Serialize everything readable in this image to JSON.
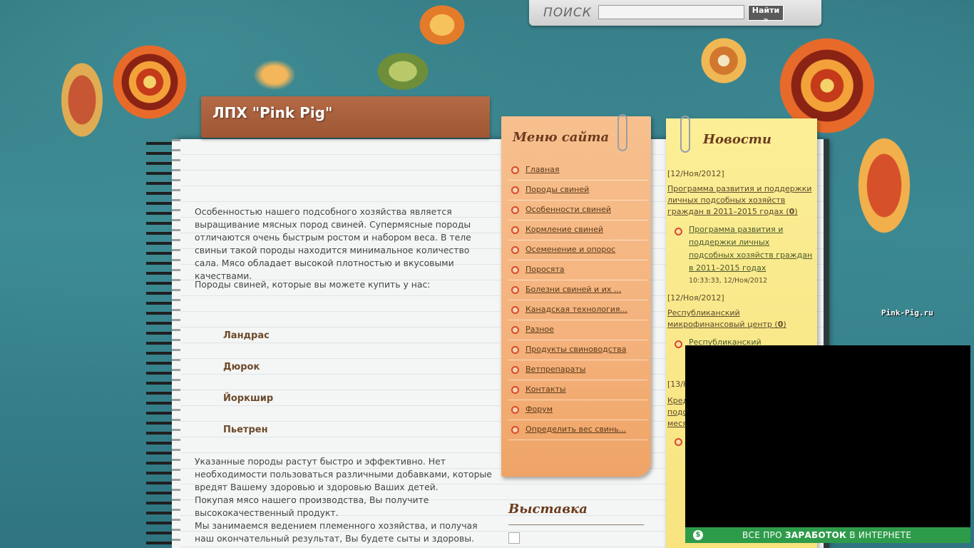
{
  "search": {
    "label": "ПОИСК",
    "input_value": "",
    "button_label": "Найти »"
  },
  "site": {
    "title": "ЛПХ \"Pink Pig\""
  },
  "main": {
    "intro": "Особенностью нашего подсобного хозяйства является выращивание мясных пород свиней. Супермясные породы отличаются очень быстрым ростом и набором веса. В  теле свиньи такой породы находится минимальное количество сала. Мясо обладает высокой плотностью и вкусовыми качествами.",
    "breeds_heading": "Породы свиней, которые вы можете купить у нас:",
    "breeds": [
      "Ландрас",
      "Дюрок",
      "Йоркшир",
      "Пьетрен"
    ],
    "outro_1": "Указанные породы растут быстро и эффективно.  Нет необходимости пользоваться различными добавками, которые вредят Вашему здоровью и здоровью Ваших детей.",
    "outro_2": "Покупая мясо нашего производства,  Вы получите высококачественный продукт.",
    "outro_3": "Мы занимаемся ведением племенного хозяйства, и получая наш окончательный результат,  Вы будете сыты и здоровы."
  },
  "menu": {
    "title": "Меню сайта",
    "items": [
      "Главная",
      "Породы свиней",
      "Особенности свиней",
      "Кормление свиней",
      "Осеменение и опорос",
      "Поросята",
      "Болезни свиней и их ...",
      "Канадская технология...",
      "Разное",
      "Продукты свиноводства",
      "Ветпрепараты",
      "Контакты",
      "Форум",
      "Определить вес свинь..."
    ]
  },
  "exhibition": {
    "title": "Выставка"
  },
  "news": {
    "title": "Новости",
    "item1_date": "[12/Ноя/2012]",
    "item1_link": "Программа развития и поддержки личных подсобных хозяйств граждан в 2011–2015 годах",
    "item1_count": "0",
    "item1_sub": "Программа развития и поддержки личных подсобных хозяйств граждан в 2011–2015 годах",
    "item1_time": "10:33:33, 12/Ноя/2012",
    "item2_date": "[12/Ноя/2012]",
    "item2_link": "Республиканский микрофинансовый центр",
    "item2_count": "0",
    "item2_sub": "Республиканский",
    "item3_date": "[13/Н",
    "item3_link": "Кред подс меся"
  },
  "side_label": "Pink-Pig.ru",
  "ad": {
    "icon": "$",
    "text_prefix": "ВСЕ ПРО ",
    "text_bold": "ЗАРАБОТОК",
    "text_suffix": " В ИНТЕРНЕТЕ"
  },
  "colors": {
    "background": "#3d8c95",
    "menu_note": "#f4b27c",
    "news_note": "#f8e37f",
    "title_banner": "#a85e3b",
    "ad_bar": "#2e9b4a"
  },
  "icons": [
    "search-icon",
    "paperclip-icon",
    "bullet-icon",
    "dollar-icon"
  ]
}
